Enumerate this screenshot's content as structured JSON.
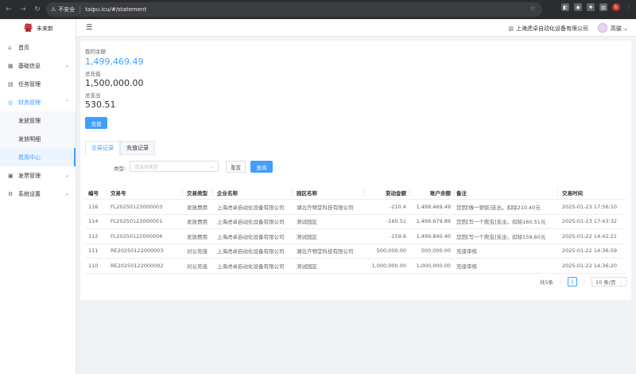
{
  "browser": {
    "insecure_label": "不安全",
    "url": "taipu.icu/#/statement"
  },
  "sidebar": {
    "logo_text": "未来新",
    "items": [
      {
        "label": "首页",
        "icon": "home-icon"
      },
      {
        "label": "基础信息",
        "icon": "grid-icon"
      },
      {
        "label": "任务管理",
        "icon": "task-icon"
      },
      {
        "label": "财务管理",
        "icon": "finance-icon"
      },
      {
        "label": "发票管理",
        "icon": "invoice-icon"
      },
      {
        "label": "系统设置",
        "icon": "gear-icon"
      }
    ],
    "finance_sub": [
      {
        "label": "发放管理"
      },
      {
        "label": "发放明细"
      },
      {
        "label": "费用中心"
      }
    ]
  },
  "header": {
    "company": "上海虎卓自动化设备有限公司",
    "username": "高骏"
  },
  "balance": {
    "balance_label": "我的余额",
    "balance_value": "1,499,469.49",
    "recharge_total_label": "总充值",
    "recharge_total_value": "1,500,000.00",
    "expense_total_label": "总支出",
    "expense_total_value": "530.51",
    "recharge_button": "充值"
  },
  "tabs": [
    {
      "label": "交易记录",
      "active": true
    },
    {
      "label": "充值记录",
      "active": false
    }
  ],
  "filter": {
    "type_label": "类型:",
    "type_placeholder": "请选择类型",
    "reset_label": "重置",
    "query_label": "查询"
  },
  "table": {
    "columns": [
      "编号",
      "交易号",
      "交易类型",
      "企业名称",
      "园区名称",
      "变动金额",
      "账户余额",
      "备注",
      "交易时间"
    ],
    "rows": [
      [
        "116",
        "FL20250123000003",
        "发放费用",
        "上海虎卓自动化设备有限公司",
        "湖北齐物堂科技有限公司",
        "-210.4",
        "1,499,469.49",
        "您因[做一顿饭]支出，扣除210.40元",
        "2025-01-23 17:56:10"
      ],
      [
        "114",
        "FL20250123000001",
        "发放费用",
        "上海虎卓自动化设备有限公司",
        "测试园区",
        "-160.51",
        "1,499,679.89",
        "您因[写一个爬虫]支出，扣除160.51元",
        "2025-01-23 17:43:32"
      ],
      [
        "112",
        "FL20250122000004",
        "发放费用",
        "上海虎卓自动化设备有限公司",
        "测试园区",
        "-159.6",
        "1,499,840.40",
        "您因[写一个爬虫]支出，扣除159.60元",
        "2025-01-22 14:42:21"
      ],
      [
        "111",
        "RE20250122000003",
        "对公充值",
        "上海虎卓自动化设备有限公司",
        "湖北齐物堂科技有限公司",
        "500,000.00",
        "500,000.00",
        "充值审核",
        "2025-01-22 14:36:59"
      ],
      [
        "110",
        "RE20250122000002",
        "对公充值",
        "上海虎卓自动化设备有限公司",
        "测试园区",
        "1,000,000.00",
        "1,000,000.00",
        "充值审核",
        "2025-01-22 14:36:20"
      ]
    ]
  },
  "pagination": {
    "total_label": "共5条",
    "current_page": "1",
    "page_size": "10 条/页"
  }
}
